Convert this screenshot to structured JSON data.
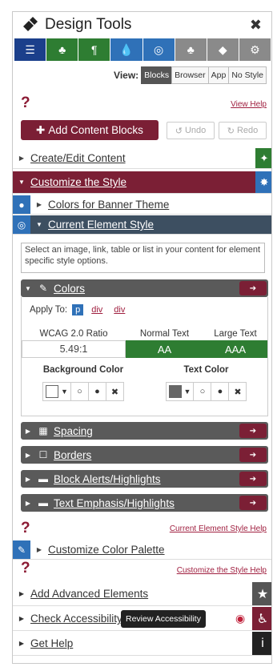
{
  "window": {
    "title": "Design Tools",
    "close": "✖"
  },
  "toolbar": {
    "icons": [
      "layout-icon",
      "sitemap-icon",
      "paragraph-icon",
      "droplet-icon",
      "target-icon",
      "users-icon",
      "tag-icon",
      "tags-icon",
      "cogs-icon"
    ]
  },
  "view": {
    "label": "View:",
    "options": [
      "Blocks",
      "Browser",
      "App",
      "No Style"
    ],
    "selected": "Blocks"
  },
  "help": {
    "view_help": "View Help",
    "current_element_help": "Current Element Style Help",
    "customize_style_help": "Customize the Style Help"
  },
  "actions": {
    "add_blocks": "Add Content Blocks",
    "undo": "Undo",
    "redo": "Redo"
  },
  "sections": {
    "create_edit": "Create/Edit Content",
    "customize_style": "Customize the Style",
    "colors_banner": "Colors for Banner Theme",
    "current_element": "Current Element Style",
    "description": "Select an image, link, table or list in your content for element specific style options.",
    "colors": "Colors",
    "spacing": "Spacing",
    "borders": "Borders",
    "block_alerts": "Block Alerts/Highlights",
    "text_emphasis": "Text Emphasis/Highlights",
    "customize_palette": "Customize Color Palette",
    "add_advanced": "Add Advanced Elements",
    "check_accessibility": "Check Accessibility",
    "get_help": "Get Help"
  },
  "apply_to": {
    "label": "Apply To:",
    "options": [
      "p",
      "div",
      "div"
    ],
    "selected": "p"
  },
  "wcag": {
    "headers": [
      "WCAG 2.0 Ratio",
      "Normal Text",
      "Large Text"
    ],
    "ratio": "5.49:1",
    "normal": "AA",
    "large": "AAA"
  },
  "color_labels": {
    "background": "Background Color",
    "text": "Text Color"
  },
  "tooltip": "Review Accessibility",
  "colors": {
    "maroon": "#7b1f35",
    "slate": "#3d4f61",
    "blue": "#2f71b8",
    "green": "#2e7d32",
    "navy": "#1b3f8b"
  }
}
